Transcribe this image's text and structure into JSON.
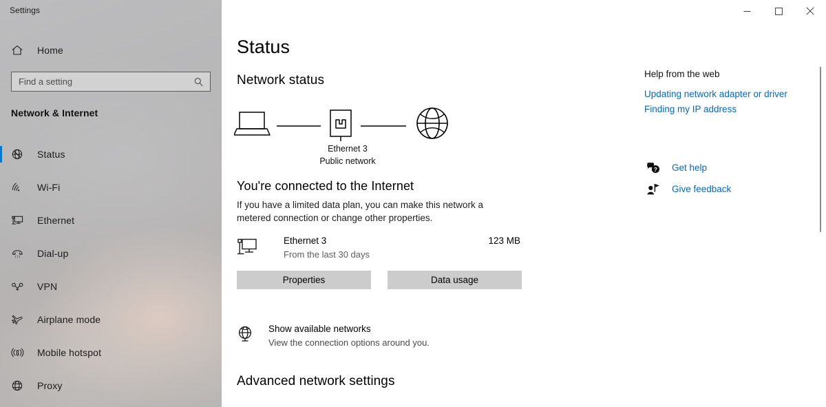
{
  "window": {
    "app_title": "Settings",
    "controls": {
      "minimize": "minimize-icon",
      "maximize": "maximize-icon",
      "close": "close-icon"
    }
  },
  "sidebar": {
    "home_label": "Home",
    "home_icon": "home-icon",
    "search": {
      "placeholder": "Find a setting",
      "value": "",
      "icon": "search-icon"
    },
    "category_title": "Network & Internet",
    "accent_color": "#0078d7",
    "items": [
      {
        "label": "Status",
        "icon": "globe-status-icon",
        "selected": true
      },
      {
        "label": "Wi-Fi",
        "icon": "wifi-icon",
        "selected": false
      },
      {
        "label": "Ethernet",
        "icon": "ethernet-icon",
        "selected": false
      },
      {
        "label": "Dial-up",
        "icon": "dialup-phone-icon",
        "selected": false
      },
      {
        "label": "VPN",
        "icon": "vpn-key-icon",
        "selected": false
      },
      {
        "label": "Airplane mode",
        "icon": "airplane-icon",
        "selected": false
      },
      {
        "label": "Mobile hotspot",
        "icon": "hotspot-icon",
        "selected": false
      },
      {
        "label": "Proxy",
        "icon": "globe-proxy-icon",
        "selected": false
      }
    ]
  },
  "main": {
    "page_title": "Status",
    "network_status_heading": "Network status",
    "network_map": {
      "device_icon": "laptop-icon",
      "adapter_icon": "network-adapter-icon",
      "internet_icon": "globe-icon",
      "adapter_name": "Ethernet 3",
      "network_type": "Public network"
    },
    "connected_heading": "You're connected to the Internet",
    "connected_description": "If you have a limited data plan, you can make this network a metered connection or change other properties.",
    "usage": {
      "icon": "ethernet-monitor-icon",
      "adapter_name": "Ethernet 3",
      "period": "From the last 30 days",
      "amount": "123 MB"
    },
    "buttons": {
      "properties": "Properties",
      "data_usage": "Data usage"
    },
    "available_networks": {
      "icon": "globe-networks-icon",
      "title": "Show available networks",
      "subtitle": "View the connection options around you."
    },
    "advanced_heading": "Advanced network settings"
  },
  "help": {
    "heading": "Help from the web",
    "link_color": "#0567c4",
    "links": [
      "Updating network adapter or driver",
      "Finding my IP address"
    ],
    "actions": [
      {
        "label": "Get help",
        "icon": "question-bubble-icon"
      },
      {
        "label": "Give feedback",
        "icon": "feedback-person-icon"
      }
    ]
  }
}
